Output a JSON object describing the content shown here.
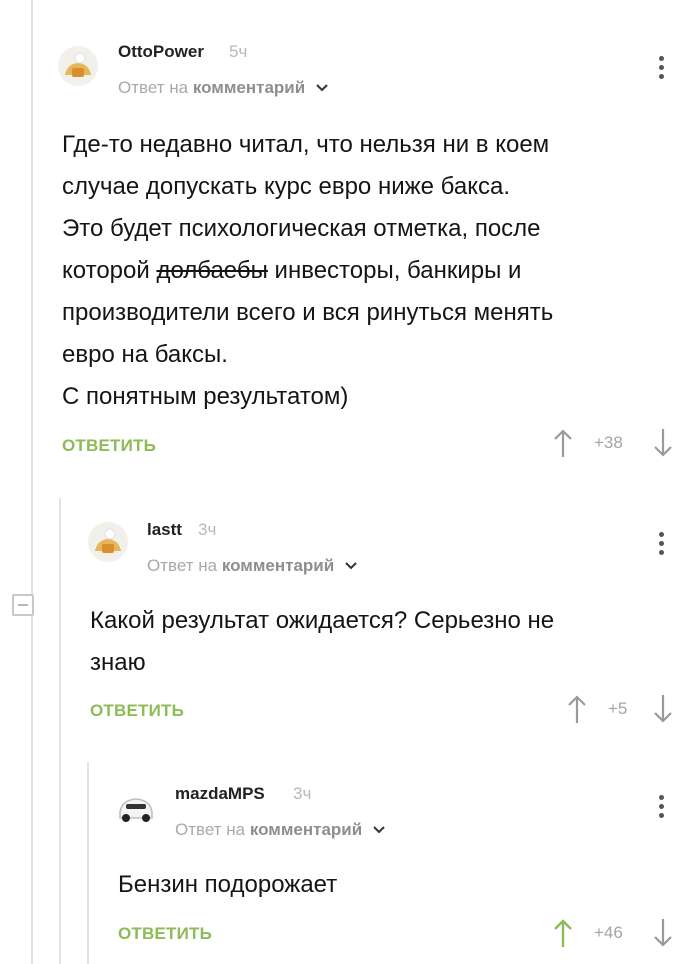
{
  "comments": [
    {
      "author": "OttoPower",
      "time": "5ч",
      "reply_prefix": "Ответ на",
      "reply_link": "комментарий",
      "text_lines": [
        "Где-то недавно читал, что нельзя ни в коем",
        "случае допускать курс евро ниже бакса.",
        "Это будет психологическая отметка, после",
        "которой ",
        "долбаебы",
        " инвесторы, банкиры и",
        "производители всего и вся ринуться менять",
        "евро на баксы.",
        "С понятным результатом)"
      ],
      "reply_label": "ОТВЕТИТЬ",
      "score": "+38"
    },
    {
      "author": "lastt",
      "time": "3ч",
      "reply_prefix": "Ответ на",
      "reply_link": "комментарий",
      "text_lines": [
        "Какой результат ожидается? Серьезно не",
        "знаю"
      ],
      "reply_label": "ОТВЕТИТЬ",
      "score": "+5"
    },
    {
      "author": "mazdaMPS",
      "time": "3ч",
      "reply_prefix": "Ответ на",
      "reply_link": "комментарий",
      "text_lines": [
        "Бензин подорожает"
      ],
      "reply_label": "ОТВЕТИТЬ",
      "score": "+46"
    }
  ],
  "colors": {
    "reply_green": "#8dbb57",
    "upvote_active": "#8dbb57",
    "arrow_gray": "#9a9a9a",
    "thread_line": "#e3e3e3"
  }
}
